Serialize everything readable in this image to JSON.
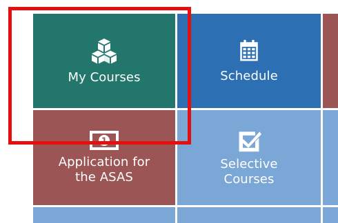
{
  "tiles": {
    "my_courses": {
      "label": "My Courses",
      "icon": "cubes-icon",
      "color": "#22766b"
    },
    "schedule": {
      "label": "Schedule",
      "icon": "calendar-icon",
      "color": "#2d6fb3"
    },
    "asas": {
      "label_line1": "Application for",
      "label_line2": "the ASAS",
      "icon": "money-bill-icon",
      "color": "#9b5555"
    },
    "selective_courses": {
      "label_line1": "Selective",
      "label_line2": "Courses",
      "icon": "checkbox-icon",
      "color": "#7aa7d6"
    }
  },
  "colors": {
    "teal": "#22766b",
    "blue": "#2d6fb3",
    "maroon": "#9b5555",
    "light_blue": "#7aa7d6",
    "highlight": "#e50f0f"
  }
}
